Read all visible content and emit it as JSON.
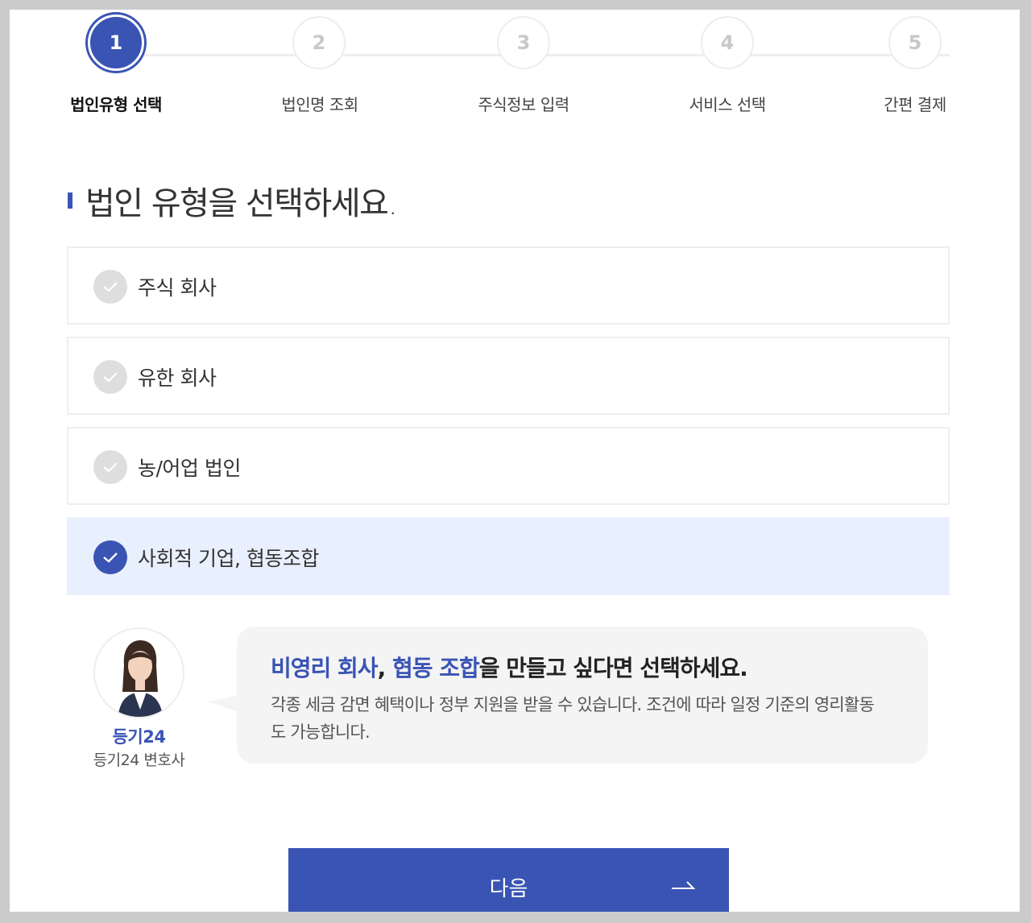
{
  "steps": [
    {
      "number": "1",
      "label": "법인유형 선택",
      "active": true
    },
    {
      "number": "2",
      "label": "법인명 조회",
      "active": false
    },
    {
      "number": "3",
      "label": "주식정보 입력",
      "active": false
    },
    {
      "number": "4",
      "label": "서비스 선택",
      "active": false
    },
    {
      "number": "5",
      "label": "간편 결제",
      "active": false
    }
  ],
  "heading": "법인 유형을 선택하세요.",
  "options": [
    {
      "label": "주식 회사",
      "selected": false
    },
    {
      "label": "유한 회사",
      "selected": false
    },
    {
      "label": "농/어업 법인",
      "selected": false
    },
    {
      "label": "사회적 기업, 협동조합",
      "selected": true
    }
  ],
  "advisor": {
    "brand": "등기24",
    "role": "등기24 변호사",
    "title_part1": "비영리 회사",
    "title_sep": ", ",
    "title_part2": "협동 조합",
    "title_rest": "을 만들고 싶다면 선택하세요.",
    "description": "각종 세금 감면 혜택이나 정부 지원을 받을 수 있습니다. 조건에 따라 일정 기준의 영리활동도 가능합니다."
  },
  "next_button": {
    "label": "다음",
    "icon": "arrow-right-icon"
  },
  "colors": {
    "accent": "#3a54b4",
    "selected_bg": "#e9f0fd",
    "check_off": "#dedede",
    "bubble_bg": "#f4f4f4"
  }
}
